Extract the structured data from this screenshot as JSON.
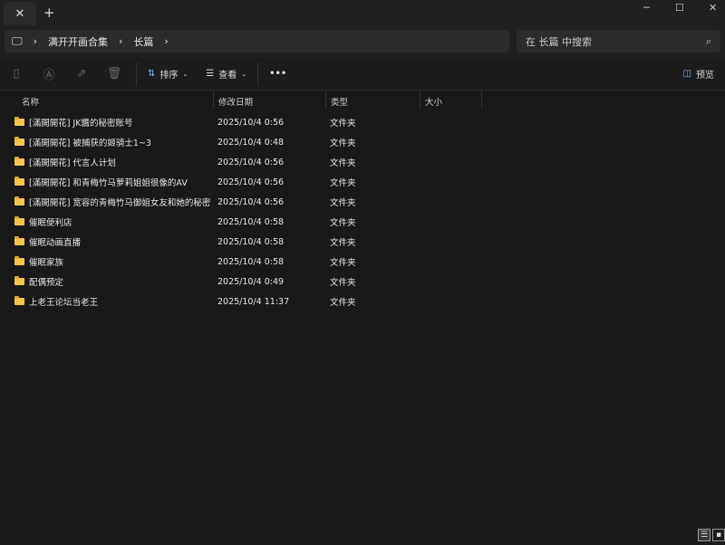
{
  "window": {
    "tab_close": "✕",
    "new_tab": "+",
    "minimize": "─",
    "maximize": "☐",
    "close": "✕"
  },
  "address": {
    "segments": [
      "满开开画合集",
      "长篇"
    ],
    "search_placeholder": "在 长篇 中搜索"
  },
  "toolbar": {
    "sort_label": "排序",
    "view_label": "查看",
    "more_label": "•••",
    "preview_label": "预览"
  },
  "columns": {
    "name": "名称",
    "date": "修改日期",
    "type": "类型",
    "size": "大小"
  },
  "files": [
    {
      "name": "[滿開開花] JK醬的秘密账号",
      "date": "2025/10/4 0:56",
      "type": "文件夹"
    },
    {
      "name": "[滿開開花] 被捕获的姬骑士1~3",
      "date": "2025/10/4 0:48",
      "type": "文件夹"
    },
    {
      "name": "[滿開開花] 代言人计划",
      "date": "2025/10/4 0:56",
      "type": "文件夹"
    },
    {
      "name": "[滿開開花] 和青梅竹马萝莉姐姐很像的AV",
      "date": "2025/10/4 0:56",
      "type": "文件夹"
    },
    {
      "name": "[滿開開花] 宽容的青梅竹马御姐女友和她的秘密",
      "date": "2025/10/4 0:56",
      "type": "文件夹"
    },
    {
      "name": "催眠便利店",
      "date": "2025/10/4 0:58",
      "type": "文件夹"
    },
    {
      "name": "催眠动画直播",
      "date": "2025/10/4 0:58",
      "type": "文件夹"
    },
    {
      "name": "催眠家族",
      "date": "2025/10/4 0:58",
      "type": "文件夹"
    },
    {
      "name": "配偶预定",
      "date": "2025/10/4 0:49",
      "type": "文件夹"
    },
    {
      "name": "上老王论坛当老王",
      "date": "2025/10/4 11:37",
      "type": "文件夹"
    }
  ]
}
